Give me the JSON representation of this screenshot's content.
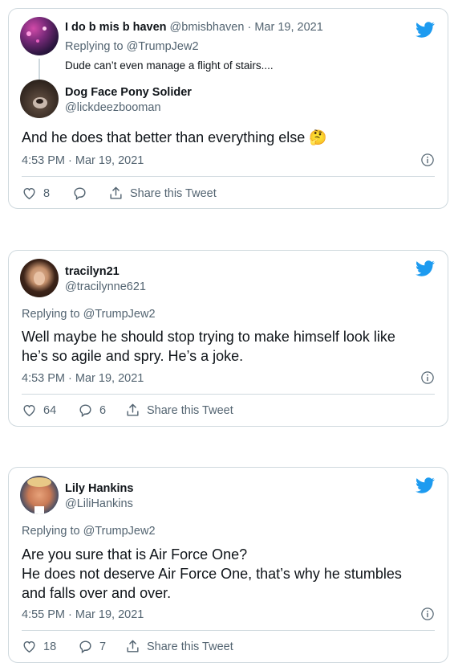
{
  "colors": {
    "twitter_blue": "#1d9bf0",
    "muted": "#536471",
    "border": "#cfd9de"
  },
  "card1": {
    "parent": {
      "name": "I do b mis b haven",
      "handle": "@bmisbhaven",
      "sep": "·",
      "date": "Mar 19, 2021",
      "replying_label": "Replying to",
      "replying_to": "@TrumpJew2",
      "text": "Dude can’t even manage a flight of stairs...."
    },
    "name": "Dog Face Pony Solider",
    "handle": "@lickdeezbooman",
    "text": "And he does that better than everything else 🤔",
    "time": "4:53 PM · Mar 19, 2021",
    "likes": "8",
    "replies": "",
    "share": "Share this Tweet"
  },
  "card2": {
    "name": "tracilyn21",
    "handle": "@tracilynne621",
    "replying_label": "Replying to",
    "replying_to": "@TrumpJew2",
    "text": "Well maybe he should stop trying to make himself look like\nhe’s so agile and spry.  He’s a joke.",
    "time": "4:53 PM · Mar 19, 2021",
    "likes": "64",
    "replies": "6",
    "share": "Share this Tweet"
  },
  "card3": {
    "name": "Lily Hankins",
    "handle": "@LiliHankins",
    "replying_label": "Replying to",
    "replying_to": "@TrumpJew2",
    "text": "Are you sure that is Air Force One?\nHe does not deserve Air Force One, that’s why he stumbles\nand falls over and over.",
    "time": "4:55 PM · Mar 19, 2021",
    "likes": "18",
    "replies": "7",
    "share": "Share this Tweet"
  }
}
